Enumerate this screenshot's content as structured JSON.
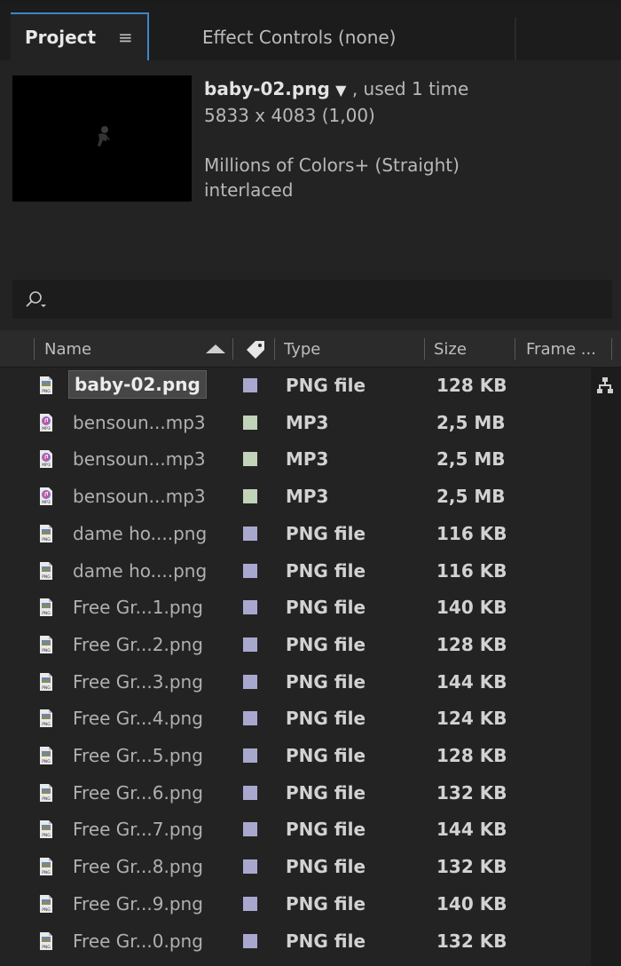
{
  "tabs": {
    "project": "Project",
    "project_menu_glyph": "≡",
    "effect_controls": "Effect Controls (none)"
  },
  "info": {
    "filename": "baby-02.png",
    "filename_arrow": "▼",
    "used": ", used 1 time",
    "dimensions": "5833 x 4083 (1,00)",
    "colors": "Millions of Colors+ (Straight)",
    "interlace": "interlaced"
  },
  "search": {
    "icon": "search-icon"
  },
  "columns": {
    "name": "Name",
    "type": "Type",
    "size": "Size",
    "frame": "Frame ..."
  },
  "colors": {
    "png_label": "#a8a8cf",
    "mp3_label": "#c1d3b8",
    "accent": "#3f86c7"
  },
  "items": [
    {
      "name": "baby-02.png",
      "type": "PNG file",
      "size": "128 KB",
      "kind": "png",
      "selected": true
    },
    {
      "name": "bensoun...mp3",
      "type": "MP3",
      "size": "2,5 MB",
      "kind": "mp3"
    },
    {
      "name": "bensoun...mp3",
      "type": "MP3",
      "size": "2,5 MB",
      "kind": "mp3"
    },
    {
      "name": "bensoun...mp3",
      "type": "MP3",
      "size": "2,5 MB",
      "kind": "mp3"
    },
    {
      "name": "dame ho....png",
      "type": "PNG file",
      "size": "116 KB",
      "kind": "png"
    },
    {
      "name": "dame ho....png",
      "type": "PNG file",
      "size": "116 KB",
      "kind": "png"
    },
    {
      "name": "Free Gr...1.png",
      "type": "PNG file",
      "size": "140 KB",
      "kind": "png"
    },
    {
      "name": "Free Gr...2.png",
      "type": "PNG file",
      "size": "128 KB",
      "kind": "png"
    },
    {
      "name": "Free Gr...3.png",
      "type": "PNG file",
      "size": "144 KB",
      "kind": "png"
    },
    {
      "name": "Free Gr...4.png",
      "type": "PNG file",
      "size": "124 KB",
      "kind": "png"
    },
    {
      "name": "Free Gr...5.png",
      "type": "PNG file",
      "size": "128 KB",
      "kind": "png"
    },
    {
      "name": "Free Gr...6.png",
      "type": "PNG file",
      "size": "132 KB",
      "kind": "png"
    },
    {
      "name": "Free Gr...7.png",
      "type": "PNG file",
      "size": "144 KB",
      "kind": "png"
    },
    {
      "name": "Free Gr...8.png",
      "type": "PNG file",
      "size": "132 KB",
      "kind": "png"
    },
    {
      "name": "Free Gr...9.png",
      "type": "PNG file",
      "size": "140 KB",
      "kind": "png"
    },
    {
      "name": "Free Gr...0.png",
      "type": "PNG file",
      "size": "132 KB",
      "kind": "png"
    }
  ]
}
